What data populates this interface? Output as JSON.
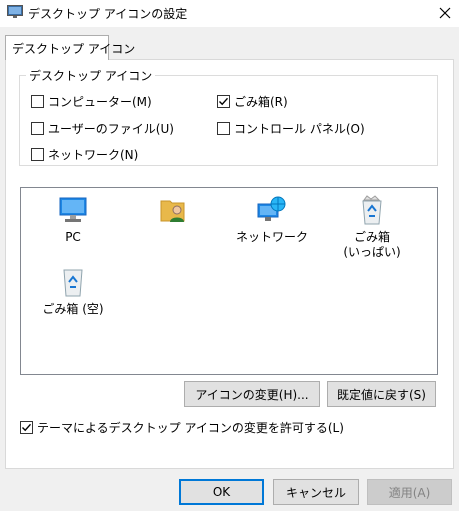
{
  "window": {
    "title": "デスクトップ アイコンの設定",
    "close_glyph": "✕"
  },
  "tabs": [
    {
      "label": "デスクトップ アイコン",
      "selected": true
    }
  ],
  "group": {
    "legend": "デスクトップ アイコン",
    "checkboxes": [
      {
        "label": "コンピューター(M)",
        "checked": false
      },
      {
        "label": "ごみ箱(R)",
        "checked": true
      },
      {
        "label": "ユーザーのファイル(U)",
        "checked": false
      },
      {
        "label": "コントロール パネル(O)",
        "checked": false
      },
      {
        "label": "ネットワーク(N)",
        "checked": false
      }
    ]
  },
  "icons": [
    {
      "label": "PC",
      "icon": "pc-icon"
    },
    {
      "label": "",
      "icon": "user-folder-icon"
    },
    {
      "label": "ネットワーク",
      "icon": "network-icon"
    },
    {
      "label": "ごみ箱\n(いっぱい)",
      "icon": "recycle-bin-full-icon"
    },
    {
      "label": "ごみ箱 (空)",
      "icon": "recycle-bin-empty-icon"
    }
  ],
  "buttons": {
    "change_icon": "アイコンの変更(H)...",
    "restore_default": "既定値に戻す(S)",
    "ok": "OK",
    "cancel": "キャンセル",
    "apply": "適用(A)"
  },
  "theme_checkbox": {
    "label": "テーマによるデスクトップ アイコンの変更を許可する(L)",
    "checked": true
  },
  "colors": {
    "accent": "#0078d7",
    "window_bg": "#f0f0f0",
    "panel_bg": "#ffffff"
  }
}
